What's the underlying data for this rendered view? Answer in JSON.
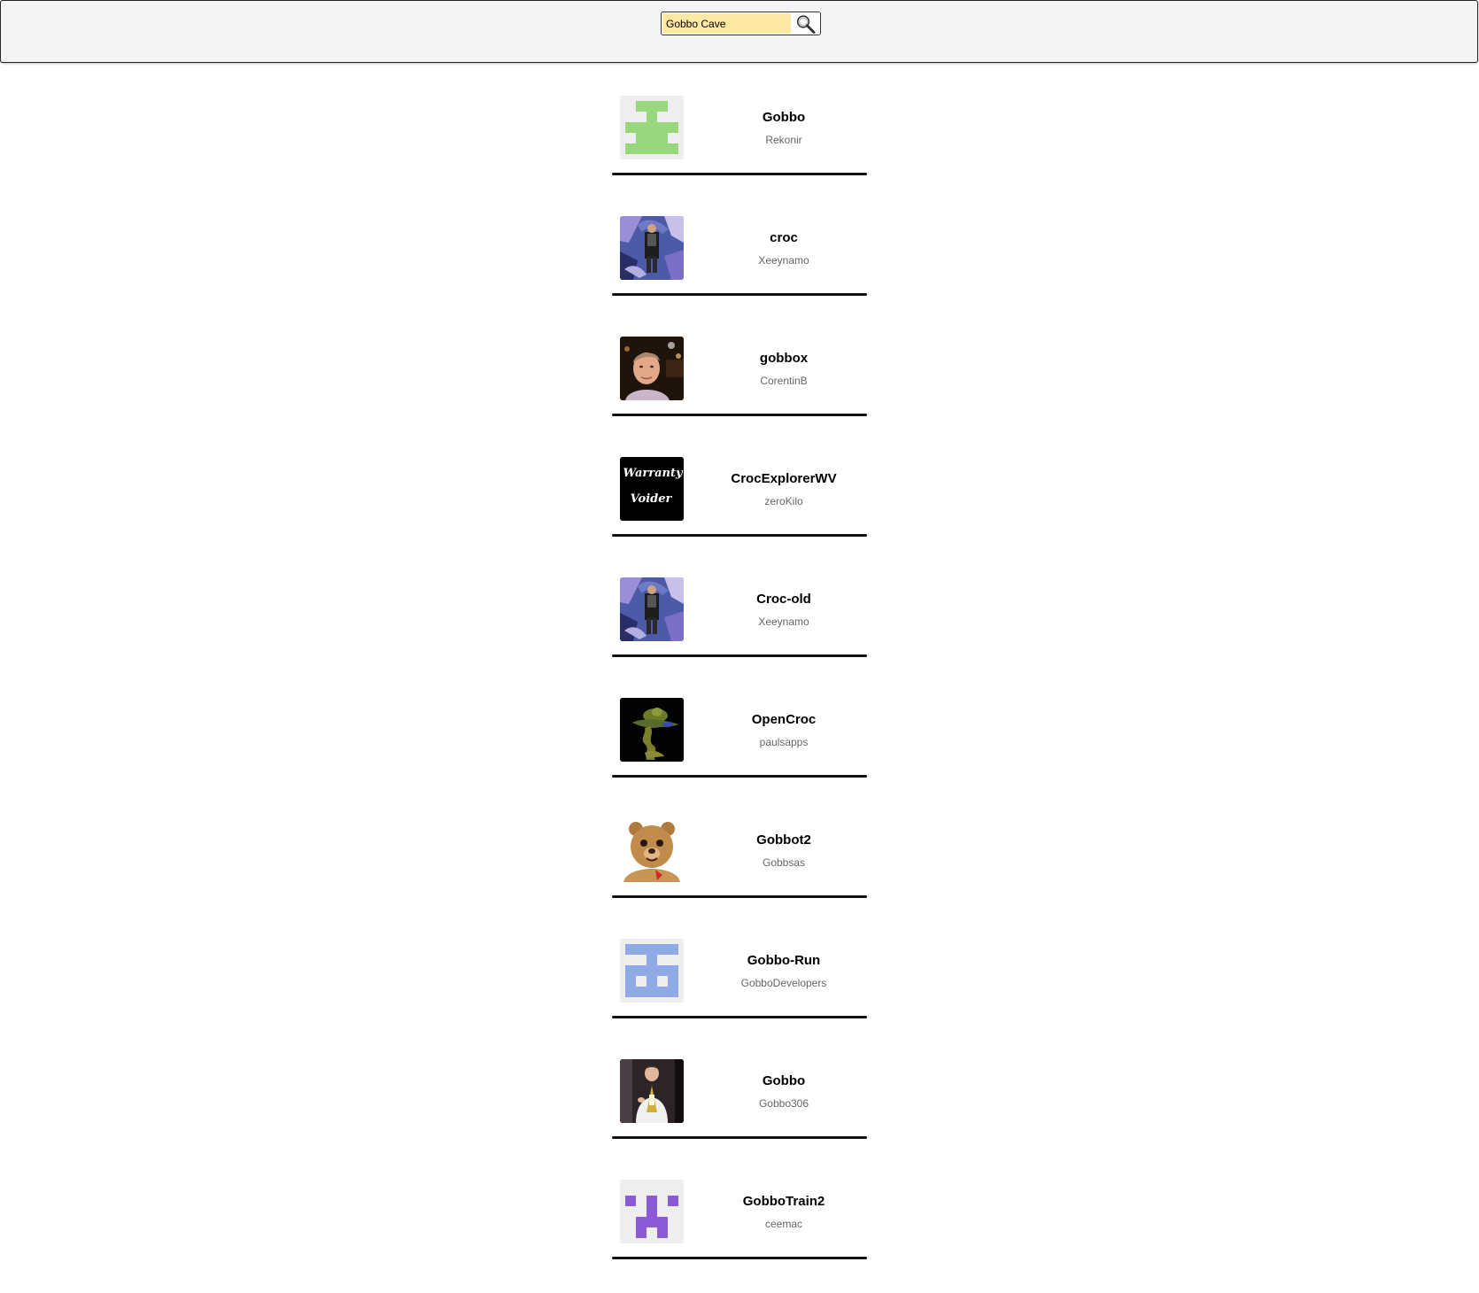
{
  "search": {
    "value": "Gobbo Cave",
    "button_icon": "magnifier-icon"
  },
  "results": [
    {
      "name": "Gobbo",
      "owner": "Rekonir",
      "avatar": "identicon-green"
    },
    {
      "name": "croc",
      "owner": "Xeeynamo",
      "avatar": "photo-person-mural"
    },
    {
      "name": "gobbox",
      "owner": "CorentinB",
      "avatar": "photo-face-night"
    },
    {
      "name": "CrocExplorerWV",
      "owner": "zeroKilo",
      "avatar": "text-logo",
      "avatar_text": [
        "Warranty",
        "Voider"
      ]
    },
    {
      "name": "Croc-old",
      "owner": "Xeeynamo",
      "avatar": "photo-person-mural"
    },
    {
      "name": "OpenCroc",
      "owner": "paulsapps",
      "avatar": "render-creature-dark"
    },
    {
      "name": "Gobbot2",
      "owner": "Gobbsas",
      "avatar": "photo-teddy-bear"
    },
    {
      "name": "Gobbo-Run",
      "owner": "GobboDevelopers",
      "avatar": "identicon-blue"
    },
    {
      "name": "Gobbo",
      "owner": "Gobbo306",
      "avatar": "photo-person-costume"
    },
    {
      "name": "GobboTrain2",
      "owner": "ceemac",
      "avatar": "identicon-purple"
    }
  ],
  "colors": {
    "header_bg": "#f4f4f4",
    "search_bg": "#ffe8a4",
    "identicon_green": "#99d77f",
    "identicon_blue": "#8fa8e6",
    "identicon_purple": "#8a5ad6",
    "owner_text": "#666666"
  }
}
